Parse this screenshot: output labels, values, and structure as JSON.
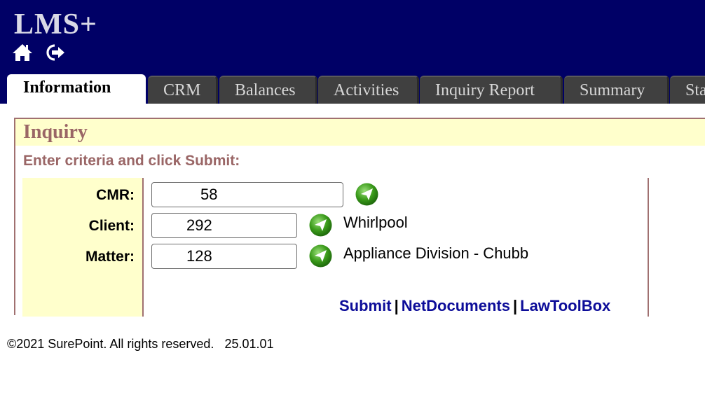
{
  "app": {
    "logo": "LMS+",
    "header_icons": [
      "home-icon",
      "logout-icon"
    ]
  },
  "tabs": [
    {
      "label": "Information",
      "active": true
    },
    {
      "label": "CRM"
    },
    {
      "label": "Balances"
    },
    {
      "label": "Activities"
    },
    {
      "label": "Inquiry Report"
    },
    {
      "label": "Summary"
    },
    {
      "label": "Sta"
    }
  ],
  "inquiry": {
    "title": "Inquiry",
    "instructions": "Enter criteria and click Submit:",
    "fields": {
      "cmr": {
        "label": "CMR:",
        "value": "58"
      },
      "client": {
        "label": "Client:",
        "value": "292",
        "description": "Whirlpool"
      },
      "matter": {
        "label": "Matter:",
        "value": "128",
        "description": "Appliance Division - Chubb"
      }
    },
    "links": {
      "submit": "Submit",
      "separator": "|",
      "netdocuments": "NetDocuments",
      "lawtoolbox": "LawToolBox"
    }
  },
  "footer": {
    "copyright": "©2021 SurePoint. All rights reserved.",
    "version": "25.01.01"
  },
  "colors": {
    "header_bg": "#000066",
    "tab_bg": "#404040",
    "panel_title_bg": "#ffffcc",
    "panel_accent": "#9a6666",
    "link": "#0d0d99",
    "go_button": "#3a9a1a"
  }
}
